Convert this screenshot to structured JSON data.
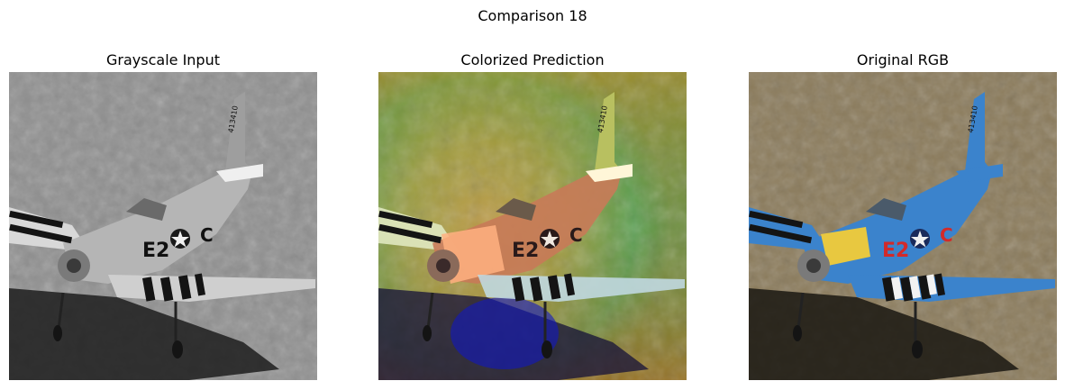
{
  "figure": {
    "title": "Comparison 18",
    "panels": [
      {
        "title": "Grayscale Input",
        "variant": "grayscale"
      },
      {
        "title": "Colorized Prediction",
        "variant": "predicted"
      },
      {
        "title": "Original RGB",
        "variant": "original"
      }
    ]
  },
  "airplane": {
    "tail_code": "413410",
    "fuselage_code": "E2",
    "fuselage_letter": "C",
    "colors": {
      "ground_original": "#8a7a5a",
      "plane_blue": "#3b83cc",
      "nose_yellow": "#e8c840",
      "code_red": "#d22a2a",
      "stripe_black": "#141414",
      "stripe_white": "#f2f2f2"
    }
  }
}
